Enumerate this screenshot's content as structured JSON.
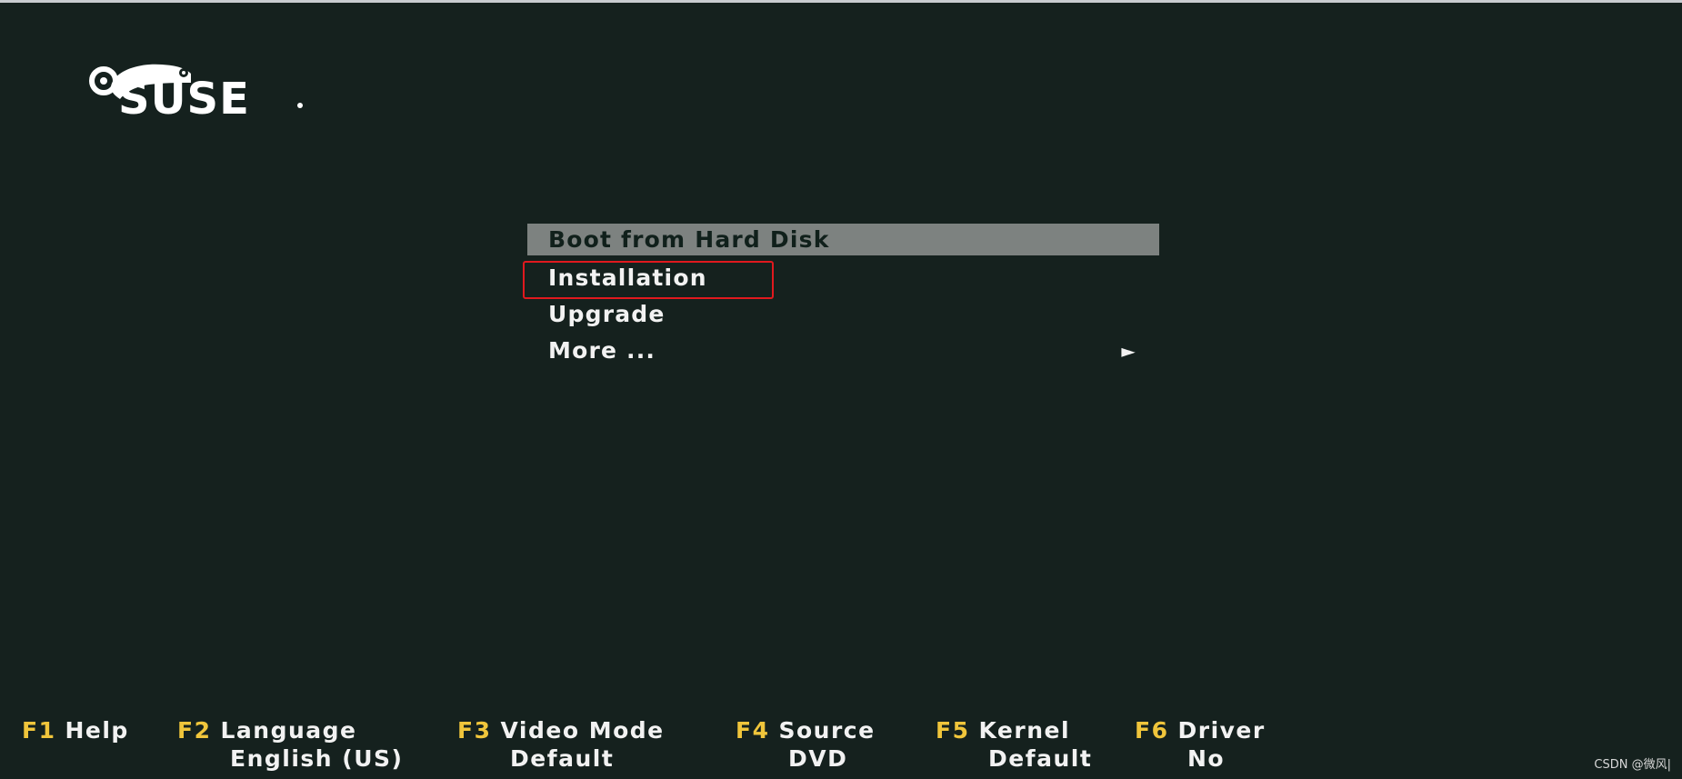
{
  "logo": {
    "text": "SUSE",
    "icon": "chameleon-icon"
  },
  "boot_menu": {
    "items": [
      {
        "label": "Boot from Hard Disk",
        "selected": true
      },
      {
        "label": "Installation",
        "selected": false,
        "annotated": true
      },
      {
        "label": "Upgrade",
        "selected": false
      },
      {
        "label": "More ...",
        "selected": false,
        "submenu_icon": "triangle-right-icon",
        "submenu_glyph": "►"
      }
    ]
  },
  "fkeys": [
    {
      "key": "F1",
      "label": "Help",
      "value": ""
    },
    {
      "key": "F2",
      "label": "Language",
      "value": "English (US)"
    },
    {
      "key": "F3",
      "label": "Video Mode",
      "value": "Default"
    },
    {
      "key": "F4",
      "label": "Source",
      "value": "DVD"
    },
    {
      "key": "F5",
      "label": "Kernel",
      "value": "Default"
    },
    {
      "key": "F6",
      "label": "Driver",
      "value": "No"
    }
  ],
  "watermark": "CSDN @微风|",
  "colors": {
    "background": "#15211e",
    "selection": "#7d8280",
    "fkey": "#f0c53b",
    "annotation": "#e0191e"
  }
}
